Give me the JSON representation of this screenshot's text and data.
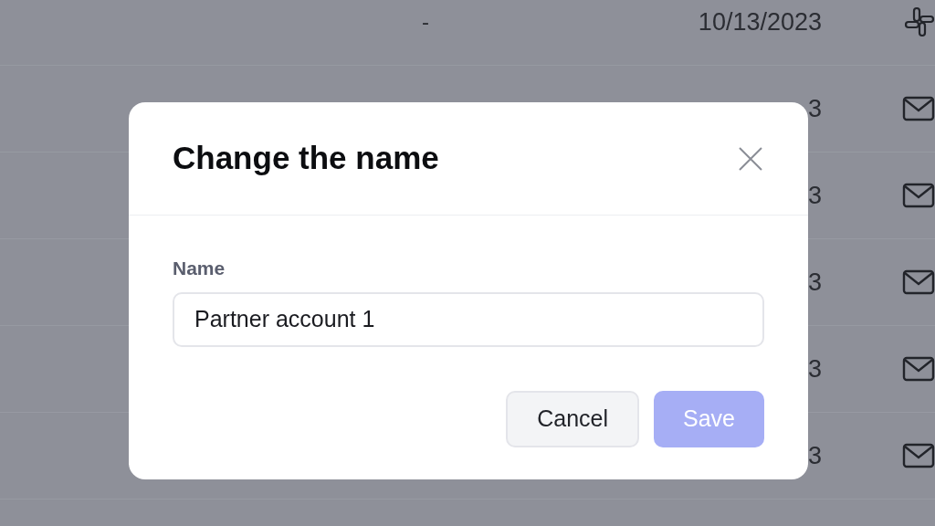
{
  "table": {
    "rows": [
      {
        "column_1": "-",
        "date": "10/13/2023",
        "kind": "app"
      },
      {
        "date": "3",
        "kind": "mail"
      },
      {
        "date": "3",
        "kind": "mail"
      },
      {
        "date": "3",
        "kind": "mail"
      },
      {
        "date": "3",
        "kind": "mail"
      },
      {
        "date": "3",
        "kind": "mail"
      }
    ]
  },
  "dialog": {
    "title": "Change the name",
    "field": {
      "label": "Name",
      "value": "Partner account 1"
    },
    "buttons": [
      {
        "label": "Cancel",
        "kind": "secondary",
        "disabled": false
      },
      {
        "label": "Save",
        "kind": "primary",
        "disabled": true
      }
    ]
  }
}
